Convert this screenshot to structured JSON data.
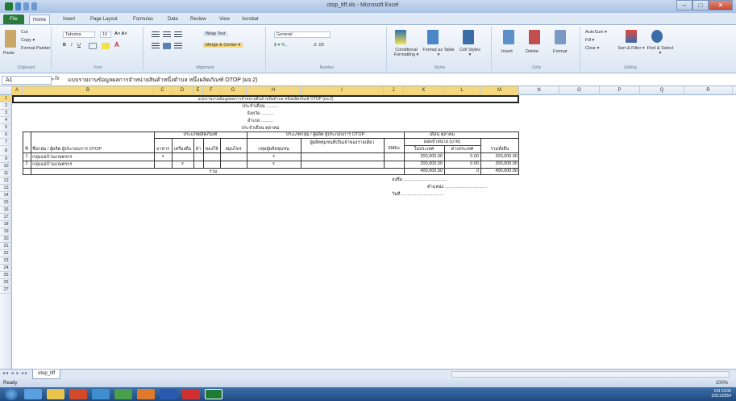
{
  "window": {
    "title": "otop_tiff.xls - Microsoft Excel"
  },
  "tabs": [
    "File",
    "Home",
    "Insert",
    "Page Layout",
    "Formulas",
    "Data",
    "Review",
    "View",
    "Acrobat"
  ],
  "ribbon": {
    "clipboard": {
      "paste": "Paste",
      "cut": "Cut",
      "copy": "Copy ▾",
      "format_painter": "Format Painter",
      "label": "Clipboard"
    },
    "font": {
      "name": "Tahoma",
      "size": "10",
      "label": "Font"
    },
    "alignment": {
      "wrap": "Wrap Text",
      "merge": "Merge & Center ▾",
      "label": "Alignment"
    },
    "number": {
      "format": "General",
      "label": "Number"
    },
    "styles": {
      "cond": "Conditional Formatting ▾",
      "table": "Format as Table ▾",
      "cell": "Cell Styles ▾",
      "label": "Styles"
    },
    "cells": {
      "insert": "Insert",
      "delete": "Delete",
      "format": "Format",
      "label": "Cells"
    },
    "editing": {
      "autosum": "AutoSum ▾",
      "fill": "Fill ▾",
      "clear": "Clear ▾",
      "sort": "Sort & Filter ▾",
      "find": "Find & Select ▾",
      "label": "Editing"
    }
  },
  "formula_bar": {
    "name_box": "A1",
    "fx": "fx",
    "content": "แบบรายงานข้อมูลผลการจำหน่ายสินค้าหนึ่งตำบล หนึ่งผลิตภัณฑ์ OTOP (ผจ.2)"
  },
  "columns": [
    "A",
    "B",
    "C",
    "D",
    "E",
    "F",
    "G",
    "H",
    "I",
    "J",
    "K",
    "L",
    "M",
    "N",
    "O",
    "P",
    "Q",
    "R"
  ],
  "rows": [
    "1",
    "2",
    "3",
    "4",
    "5",
    "6",
    "7",
    "8",
    "9",
    "10",
    "11",
    "12",
    "13",
    "14",
    "15",
    "16",
    "17",
    "18",
    "19",
    "20",
    "21",
    "22",
    "23",
    "24",
    "25",
    "26",
    "27"
  ],
  "sheet": {
    "title": "แบบรายงานข้อมูลผลการจำหน่ายสินค้าหนึ่งตำบล หนึ่งผลิตภัณฑ์ OTOP (ผจ.2)",
    "month": "ประจำเดือน ..........",
    "province": "จังหวัด ..........",
    "district": "อำเภอ ..........",
    "subtitle": "ประจำเดือน ตุลาคม",
    "h_type": "ประเภทผลิตภัณฑ์",
    "h_producer": "ประเภทกลุ่ม / ผู้ผลิต ผู้ประกอบการ OTOP",
    "h_sales": "ยอดจำหน่าย (บาท)",
    "h_month": "เดือน ตุลาคม",
    "h_num": "ที่",
    "h_name": "ชื่อกลุ่ม / ผู้ผลิต ผู้ประกอบการ OTOP",
    "h_sub": [
      "อาหาร",
      "เครื่องดื่ม",
      "ผ้า",
      "ของใช้",
      "สมุนไพร"
    ],
    "h_grp": "กลุ่มผู้ผลิตชุมชน",
    "h_single": "ผู้ผลิตชุมชนที่เป็นเจ้าของรายเดียว",
    "h_sme": "SMEs",
    "h_in": "ในประเทศ",
    "h_out": "ต่างประเทศ",
    "h_total": "รวมทั้งสิ้น",
    "data": [
      {
        "no": "1",
        "name": "กลุ่มแม่บ้านเกษตรกร",
        "mark_food": "x",
        "mark_type": "x",
        "in": "200,000.00",
        "out": "0.00",
        "total": "200,000.00"
      },
      {
        "no": "2",
        "name": "กลุ่มแม่บ้านเกษตรกร",
        "mark_drink": "x",
        "mark_type": "x",
        "in": "200,000.00",
        "out": "0.00",
        "total": "200,000.00"
      }
    ],
    "sum_label": "รวม",
    "sum_in": "400,000.00",
    "sum_out": "0",
    "sum_total": "400,000.00",
    "sign_label": "ลงชื่อ ...................................",
    "position": "ตำแหน่ง ..................................",
    "date_label": "วันที่ ..................................."
  },
  "sheet_tab": "otop_tiff",
  "status": {
    "mode": "Ready",
    "zoom": "100%"
  },
  "taskbar": {
    "lang": "EN",
    "time": "13:06",
    "date": "10/11/2554"
  }
}
